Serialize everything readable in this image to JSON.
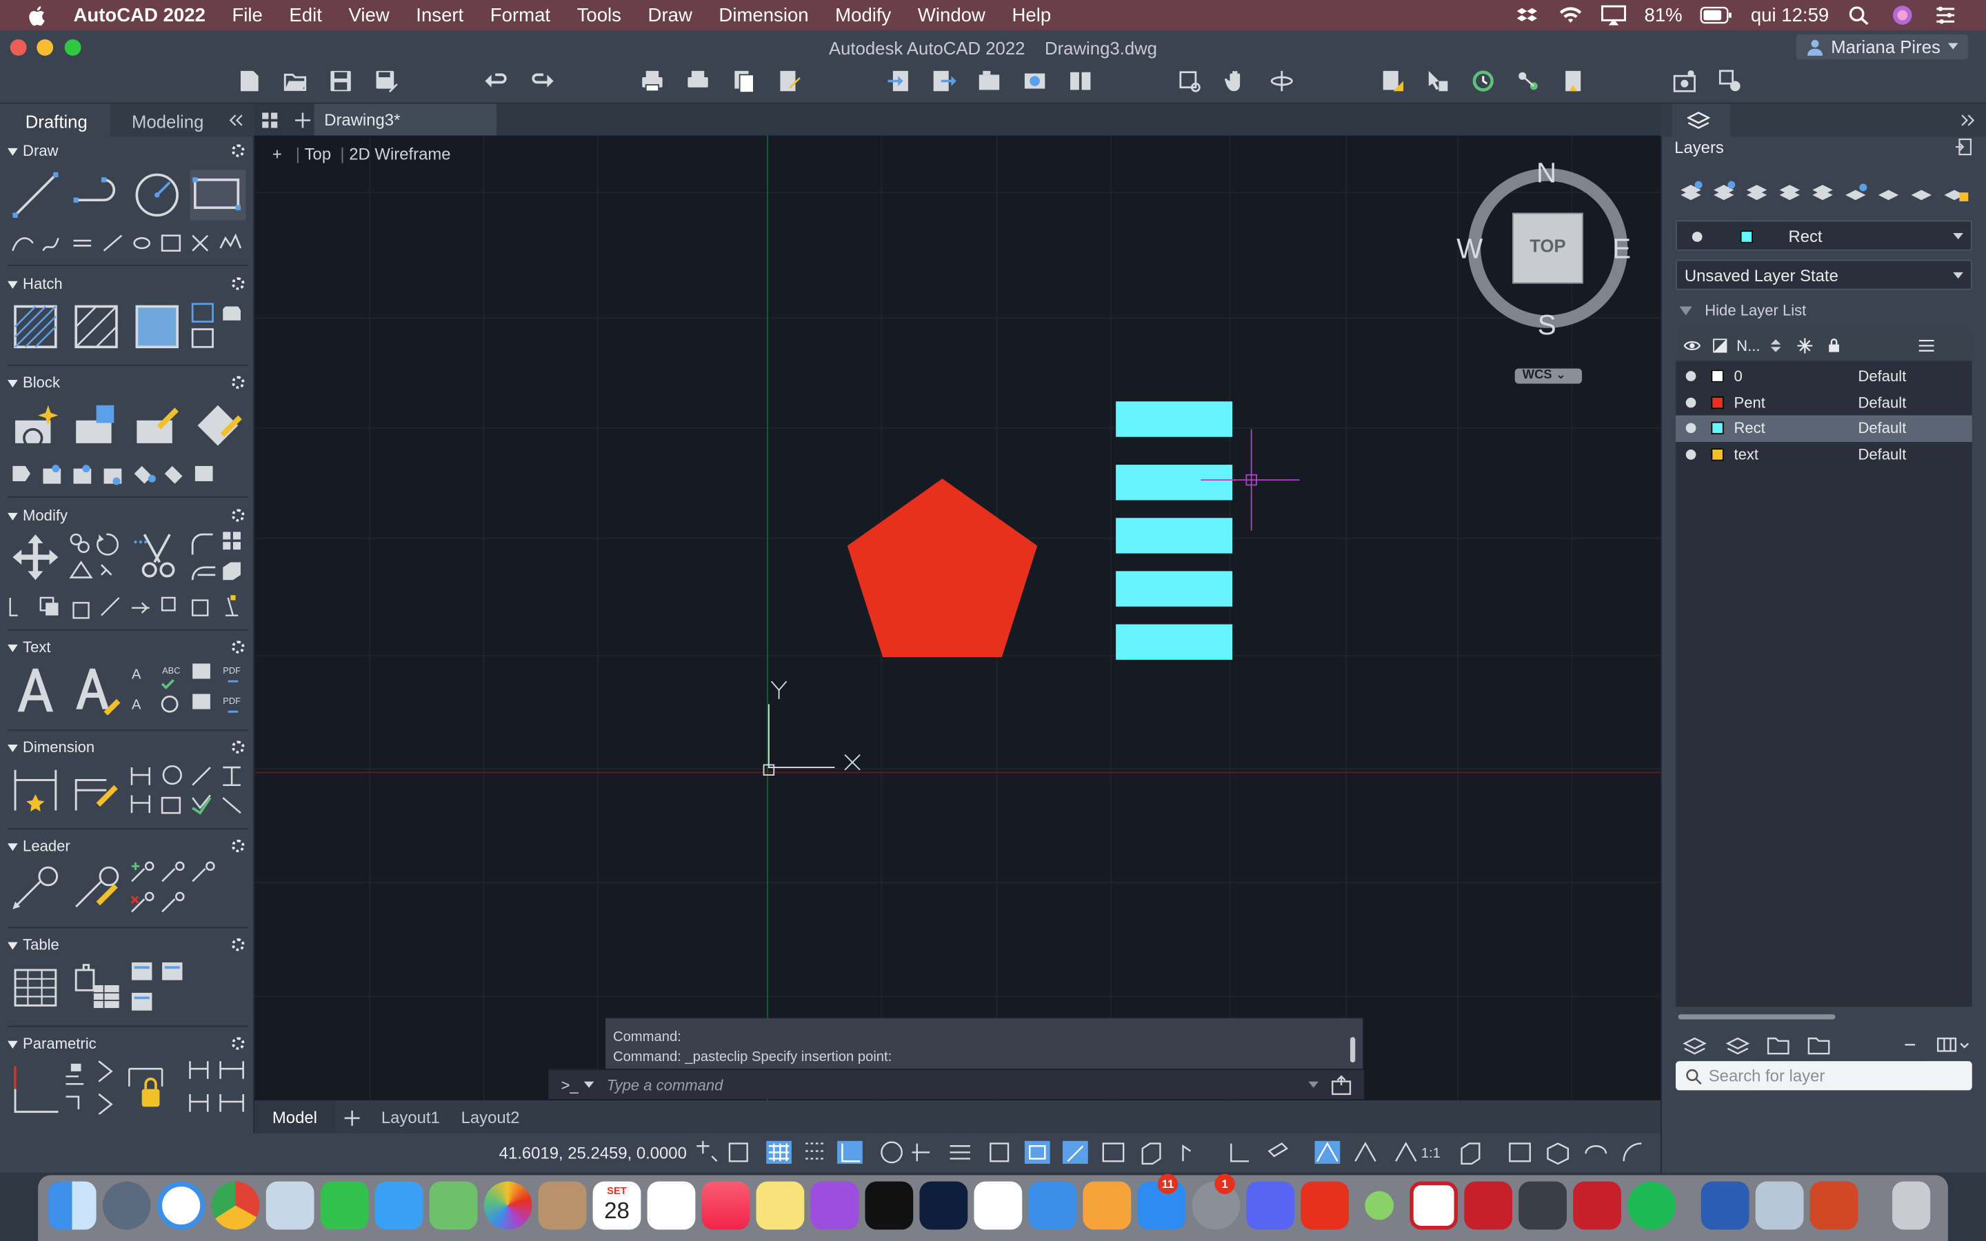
{
  "menubar": {
    "app_name": "AutoCAD 2022",
    "items": [
      "File",
      "Edit",
      "View",
      "Insert",
      "Format",
      "Tools",
      "Draw",
      "Dimension",
      "Modify",
      "Window",
      "Help"
    ],
    "battery": "81%",
    "clock": "qui 12:59"
  },
  "window": {
    "title": "Autodesk AutoCAD 2022",
    "filename": "Drawing3.dwg",
    "user": "Mariana Pires"
  },
  "palette": {
    "tabs": [
      "Drafting",
      "Modeling"
    ],
    "active_tab": "Drafting",
    "collapse_icon": "double-chevron-left-icon",
    "sections": [
      "Draw",
      "Hatch",
      "Block",
      "Modify",
      "Text",
      "Dimension",
      "Leader",
      "Table",
      "Parametric"
    ]
  },
  "document": {
    "tab": "Drawing3*",
    "viewport_plus": "+",
    "view": "Top",
    "visual_style": "2D Wireframe"
  },
  "viewcube": {
    "face": "TOP",
    "north": "N",
    "south": "S",
    "east": "E",
    "west": "W",
    "ucs": "WCS"
  },
  "ucs_icon": {
    "y_label": "Y",
    "x_label": "X"
  },
  "drawing": {
    "pentagon_color": "#e8301f",
    "rect_color": "#66f5ff",
    "rect_count": 5,
    "cursor_color": "#b040c8"
  },
  "command": {
    "history": [
      "Command:",
      "Command: _pasteclip Specify insertion point:"
    ],
    "prompt_icon": ">_",
    "placeholder": "Type a command"
  },
  "layout_tabs": [
    "Model",
    "Layout1",
    "Layout2"
  ],
  "layout_active": "Model",
  "status": {
    "coordinates": "41.6019, 25.2459, 0.0000",
    "scale": "1:1"
  },
  "layers": {
    "title": "Layers",
    "current_layer": "Rect",
    "layer_state": "Unsaved Layer State",
    "hide_list": "Hide Layer List",
    "name_header": "N...",
    "rows": [
      {
        "name": "0",
        "desc": "Default",
        "color": "#ffffff"
      },
      {
        "name": "Pent",
        "desc": "Default",
        "color": "#e8301f"
      },
      {
        "name": "Rect",
        "desc": "Default",
        "color": "#66f5ff"
      },
      {
        "name": "text",
        "desc": "Default",
        "color": "#f2c02a"
      }
    ],
    "selected": "Rect",
    "search_placeholder": "Search for layer"
  },
  "dock": {
    "calendar_month": "SET",
    "calendar_day": "28",
    "badge_appstore": "11",
    "badge_prefs": "1",
    "apps": [
      "Finder",
      "Launchpad",
      "Safari",
      "Chrome",
      "Preview",
      "FaceTime",
      "Messages",
      "Maps",
      "Photos",
      "Contacts",
      "Calendar",
      "Reminders",
      "Music",
      "Notes",
      "Podcasts",
      "TV",
      "Photoshop",
      "Numbers",
      "Keynote",
      "Pages",
      "App Store",
      "System Preferences",
      "Discord",
      "Sparrow",
      "Lime",
      "AutoCAD",
      "AutoCAD LT",
      "Sublime Text",
      "FileZilla",
      "Spotify",
      "Word",
      "Preview 2",
      "PowerPoint",
      "Trash"
    ]
  }
}
